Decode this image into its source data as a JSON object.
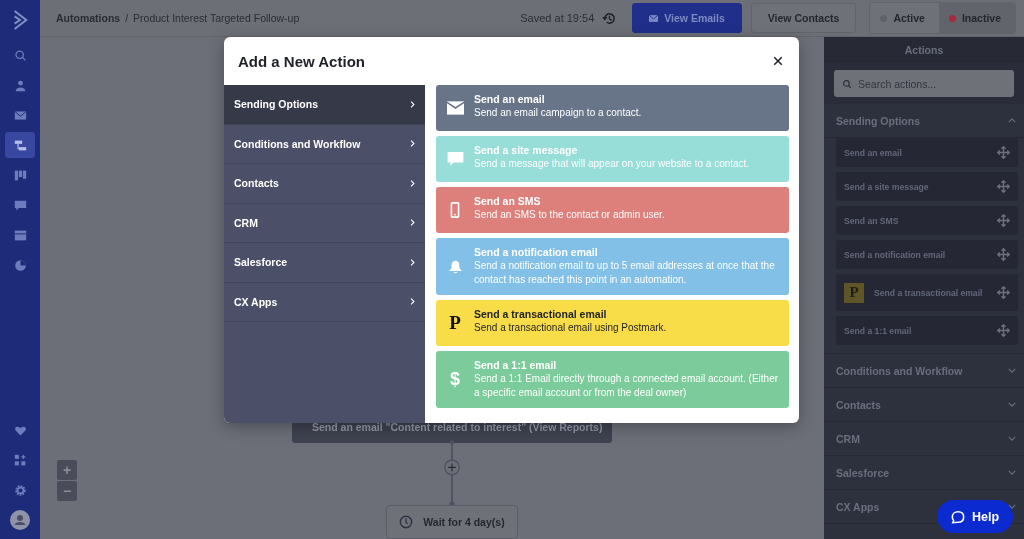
{
  "nav": {
    "items": [
      {
        "kind": "search",
        "selected": false
      },
      {
        "kind": "person",
        "selected": false
      },
      {
        "kind": "mail",
        "selected": false
      },
      {
        "kind": "flow",
        "selected": true
      },
      {
        "kind": "board",
        "selected": false
      },
      {
        "kind": "chat",
        "selected": false
      },
      {
        "kind": "list",
        "selected": false
      },
      {
        "kind": "pie",
        "selected": false
      }
    ],
    "bottom": [
      {
        "kind": "heart"
      },
      {
        "kind": "apps"
      },
      {
        "kind": "gear"
      },
      {
        "kind": "avatar"
      }
    ]
  },
  "header": {
    "breadcrumb_root": "Automations",
    "separator": "/",
    "breadcrumb_current": "Product Interest Targeted Follow-up",
    "saved": "Saved at 19:54",
    "buttons": [
      {
        "label": "View Emails",
        "kind": "primary"
      },
      {
        "label": "View Contacts",
        "kind": "secondary"
      }
    ],
    "status_toggle": [
      {
        "label": "Active",
        "selected": false,
        "color": "#5f6168"
      },
      {
        "label": "Inactive",
        "selected": true,
        "color": "#a8293f"
      }
    ]
  },
  "canvas": {
    "nodes": [
      {
        "kind": "action",
        "text": "Send an email \"Content related to interest\" (View Reports)"
      },
      {
        "kind": "wait",
        "text": "Wait for 4 day(s)"
      }
    ],
    "zoom": [
      "+",
      "−"
    ]
  },
  "modal": {
    "title": "Add a New Action",
    "categories": [
      {
        "label": "Sending Options",
        "selected": true
      },
      {
        "label": "Conditions and Workflow",
        "selected": false
      },
      {
        "label": "Contacts",
        "selected": false
      },
      {
        "label": "CRM",
        "selected": false
      },
      {
        "label": "Salesforce",
        "selected": false
      },
      {
        "label": "CX Apps",
        "selected": false
      }
    ],
    "actions": [
      {
        "kind": "email",
        "title": "Send an email",
        "description": "Send an email campaign to a contact.",
        "color": "#687488"
      },
      {
        "kind": "message",
        "title": "Send a site message",
        "description": "Send a message that will appear on your website to a contact.",
        "color": "#97ddd8"
      },
      {
        "kind": "sms",
        "title": "Send an SMS",
        "description": "Send an SMS to the contact or admin user.",
        "color": "#dd7f7b"
      },
      {
        "kind": "bell",
        "title": "Send a notification email",
        "description": "Send a notification email to up to 5 email addresses at once that the contact has reached this point in an automation.",
        "color": "#82c0e8"
      },
      {
        "kind": "letter",
        "icon_text": "P",
        "title": "Send a transactional email",
        "description": "Send a transactional email using Postmark.",
        "color": "#f8dc48"
      },
      {
        "kind": "letter",
        "icon_text": "$",
        "title": "Send a 1:1 email",
        "description": "Send a 1:1 Email directly through a connected email account. (Either a specific email account or from the deal owner)",
        "color": "#7ccb9a"
      }
    ]
  },
  "actions_panel": {
    "title": "Actions",
    "search": {
      "placeholder": "Search actions..."
    },
    "sections": [
      {
        "title": "Sending Options",
        "expanded": true,
        "items": [
          {
            "label": "Send an email"
          },
          {
            "label": "Send a site message"
          },
          {
            "label": "Send an SMS"
          },
          {
            "label": "Send a notification email"
          },
          {
            "label": "Send a transactional email",
            "logo_text": "P"
          },
          {
            "label": "Send a 1:1 email"
          }
        ]
      },
      {
        "title": "Conditions and Workflow",
        "expanded": false
      },
      {
        "title": "Contacts",
        "expanded": false
      },
      {
        "title": "CRM",
        "expanded": false
      },
      {
        "title": "Salesforce",
        "expanded": false
      },
      {
        "title": "CX Apps",
        "expanded": false
      }
    ]
  },
  "help": {
    "label": "Help"
  }
}
